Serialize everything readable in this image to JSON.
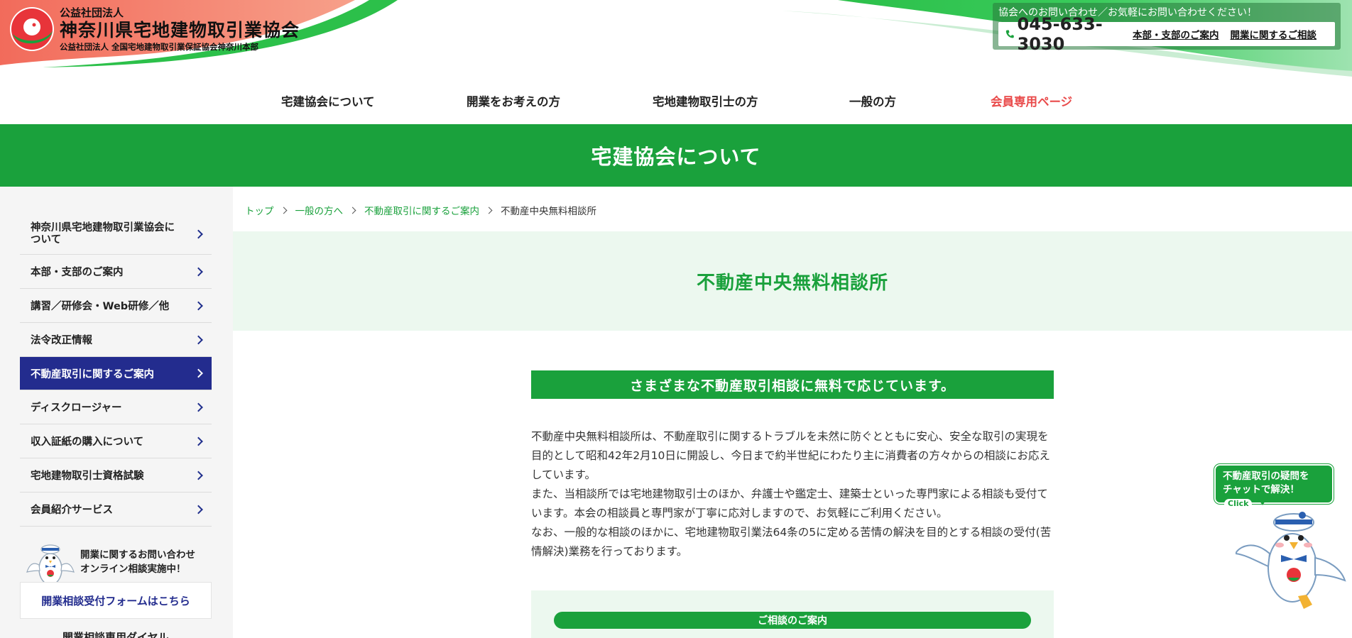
{
  "header": {
    "org_type": "公益社団法人",
    "org_name": "神奈川県宅地建物取引業協会",
    "org_sub": "公益社団法人 全国宅地建物取引業保証協会神奈川本部",
    "contact_caption": "協会へのお問い合わせ／お気軽にお問い合わせください！",
    "phone": "045-633-3030",
    "links": [
      "本部・支部のご案内",
      "開業に関するご相談"
    ]
  },
  "nav": {
    "items": [
      "宅建協会について",
      "開業をお考えの方",
      "宅地建物取引士の方",
      "一般の方",
      "会員専用ページ"
    ]
  },
  "title_band": "宅建協会について",
  "sidebar": {
    "items": [
      {
        "label": "神奈川県宅地建物取引業協会について",
        "active": false
      },
      {
        "label": "本部・支部のご案内",
        "active": false
      },
      {
        "label": "講習／研修会・Web研修／他",
        "active": false
      },
      {
        "label": "法令改正情報",
        "active": false
      },
      {
        "label": "不動産取引に関するご案内",
        "active": true
      },
      {
        "label": "ディスクロージャー",
        "active": false
      },
      {
        "label": "収入証紙の購入について",
        "active": false
      },
      {
        "label": "宅地建物取引士資格試験",
        "active": false
      },
      {
        "label": "会員紹介サービス",
        "active": false
      }
    ],
    "consult_line1": "開業に関するお問い合わせ",
    "consult_line2": "オンライン相談実施中！",
    "consult_button": "開業相談受付フォームはこちら",
    "consult_dial": "開業相談専用ダイヤル"
  },
  "breadcrumb": {
    "items": [
      "トップ",
      "一般の方へ",
      "不動産取引に関するご案内"
    ],
    "current": "不動産中央無料相談所"
  },
  "page_title": "不動産中央無料相談所",
  "content": {
    "lead": "さまざまな不動産取引相談に無料で応じています。",
    "paragraphs": [
      "不動産中央無料相談所は、不動産取引に関するトラブルを未然に防ぐとともに安心、安全な取引の実現を目的として昭和42年2月10日に開設し、今日まで約半世紀にわたり主に消費者の方々からの相談にお応えしています。",
      "また、当相談所では宅地建物取引士のほか、弁護士や鑑定士、建築士といった専門家による相談も受付ています。本会の相談員と専門家が丁寧に応対しますので、お気軽にご利用ください。",
      "なお、一般的な相談のほかに、宅地建物取引業法64条の5に定める苦情の解決を目的とする相談の受付(苦情解決)業務を行っております。"
    ],
    "consult_guide": "ご相談のご案内"
  },
  "chat": {
    "line1": "不動産取引の疑問を",
    "line2": "チャットで解決！",
    "badge": "Click"
  },
  "colors": {
    "green": "#1aa13c",
    "navy": "#232c8e",
    "member_red": "#e94b4b",
    "light_green": "#ecf8ef"
  }
}
